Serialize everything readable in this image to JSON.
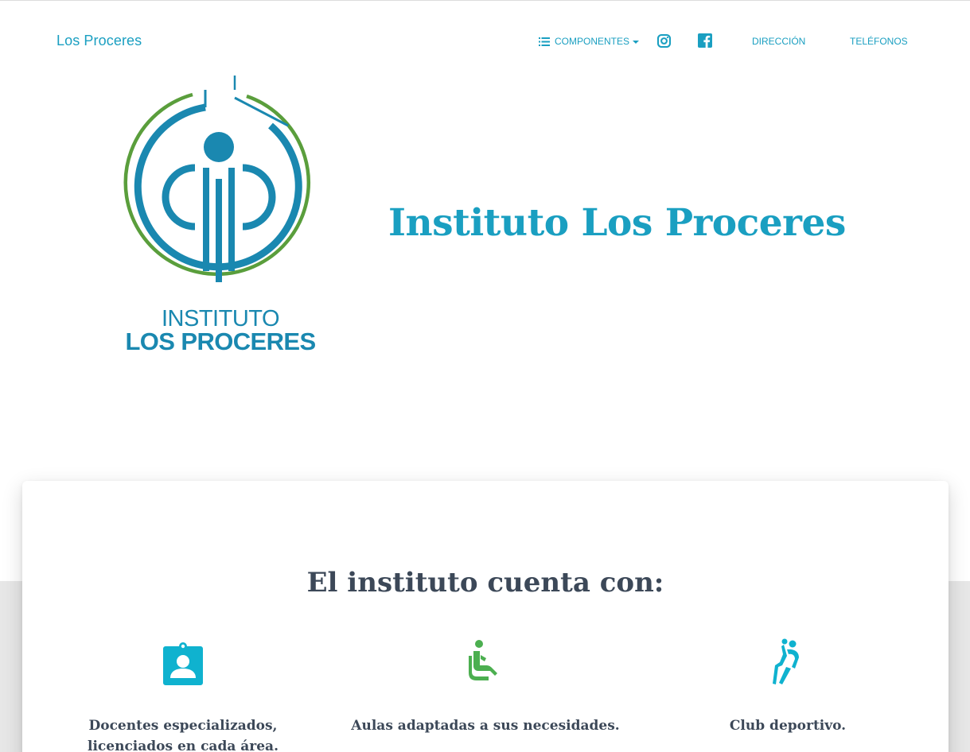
{
  "navbar": {
    "brand": "Los Proceres",
    "items": [
      {
        "label": "Componentes",
        "icon": "list-icon",
        "has_caret": true
      },
      {
        "label": "",
        "icon": "instagram-icon"
      },
      {
        "label": "",
        "icon": "facebook-icon"
      },
      {
        "label": "Dirección"
      },
      {
        "label": "Teléfonos"
      }
    ]
  },
  "hero": {
    "logo": {
      "line1": "INSTITUTO",
      "line2": "LOS PROCERES"
    },
    "title": "Instituto Los Proceres"
  },
  "features_section": {
    "title": "El instituto cuenta con:",
    "items": [
      {
        "icon": "clipboard-account-icon",
        "color": "#0fb2cf",
        "text": "Docentes especializados, licenciados en cada área."
      },
      {
        "icon": "accessible-seat-icon",
        "color": "#4caf50",
        "text": "Aulas adaptadas a sus necesidades."
      },
      {
        "icon": "sports-handball-icon",
        "color": "#0fb2cf",
        "text": "Club deportivo."
      }
    ]
  },
  "colors": {
    "primary": "#1a9fc1",
    "info": "#0fb2cf",
    "success": "#4caf50",
    "logo_blue": "#1a88b0",
    "logo_green": "#5a9e3c",
    "heading": "#3c4858"
  }
}
